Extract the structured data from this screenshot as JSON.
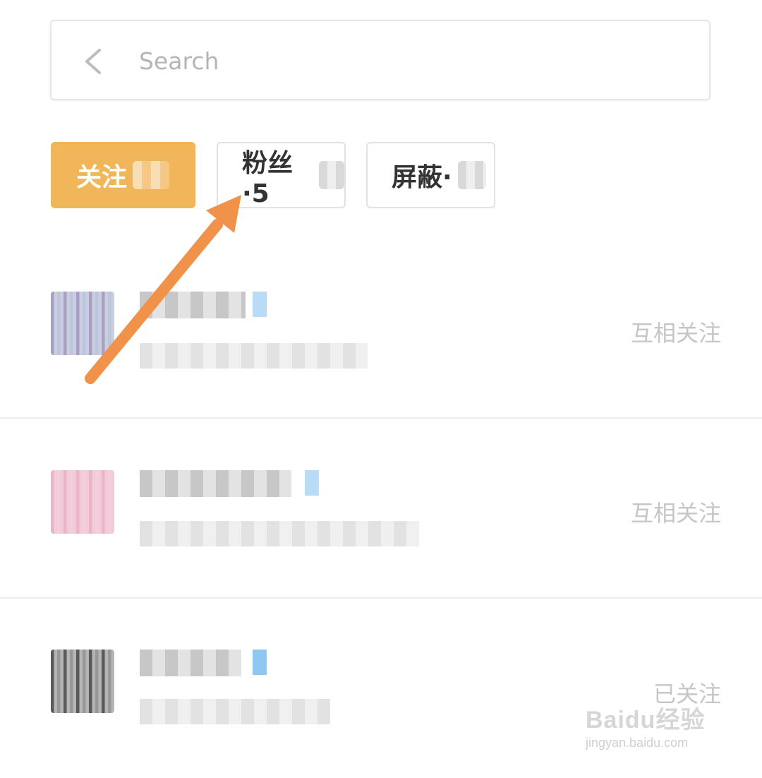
{
  "search": {
    "placeholder": "Search"
  },
  "tabs": [
    {
      "label": "关注",
      "active": true
    },
    {
      "label": "粉丝·5",
      "active": false
    },
    {
      "label": "屏蔽·",
      "active": false
    }
  ],
  "follow_list": [
    {
      "status": "互相关注"
    },
    {
      "status": "互相关注"
    },
    {
      "status": "已关注"
    }
  ],
  "annotation": {
    "arrow_color": "#f0924a",
    "points_to": "粉丝"
  },
  "colors": {
    "accent": "#f2b65a",
    "status_text": "#c6c6c6",
    "arrow": "#f0924a"
  },
  "watermark": {
    "logo": "Baidu经验",
    "url": "jingyan.baidu.com"
  }
}
